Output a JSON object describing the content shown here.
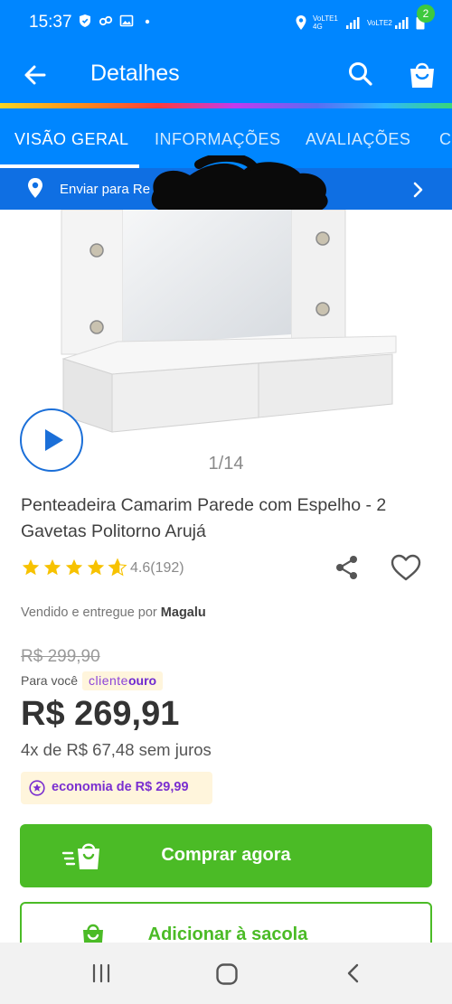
{
  "status_bar": {
    "time": "15:37",
    "sim1": "VoLTE1 4G",
    "sim2": "VoLTE2"
  },
  "app_bar": {
    "title": "Detalhes",
    "cart_count": "2"
  },
  "tabs": [
    {
      "label": "VISÃO GERAL",
      "active": true
    },
    {
      "label": "INFORMAÇÕES",
      "active": false
    },
    {
      "label": "AVALIAÇÕES",
      "active": false
    },
    {
      "label": "C",
      "active": false
    }
  ],
  "shipping": {
    "label": "Enviar para Re"
  },
  "gallery": {
    "counter": "1/14"
  },
  "product": {
    "title": "Penteadeira Camarim Parede com Espelho - 2 Gavetas Politorno Arujá",
    "rating_value": 4.6,
    "rating_text": "4.6(192)",
    "seller_prefix": "Vendido e entregue por",
    "seller_name": "Magalu"
  },
  "pricing": {
    "old_price": "R$ 299,90",
    "para_voce": "Para você",
    "club_cliente": "cliente",
    "club_ouro": "ouro",
    "price": "R$ 269,91",
    "installments": "4x de R$ 67,48 sem juros",
    "savings": "economia de R$ 29,99"
  },
  "actions": {
    "buy_label": "Comprar agora",
    "add_to_bag_label": "Adicionar à sacola"
  },
  "colors": {
    "brand_blue": "#0086ff",
    "buy_green": "#4bbb26",
    "star_yellow": "#f7c200",
    "club_purple": "#7a2fd0"
  }
}
